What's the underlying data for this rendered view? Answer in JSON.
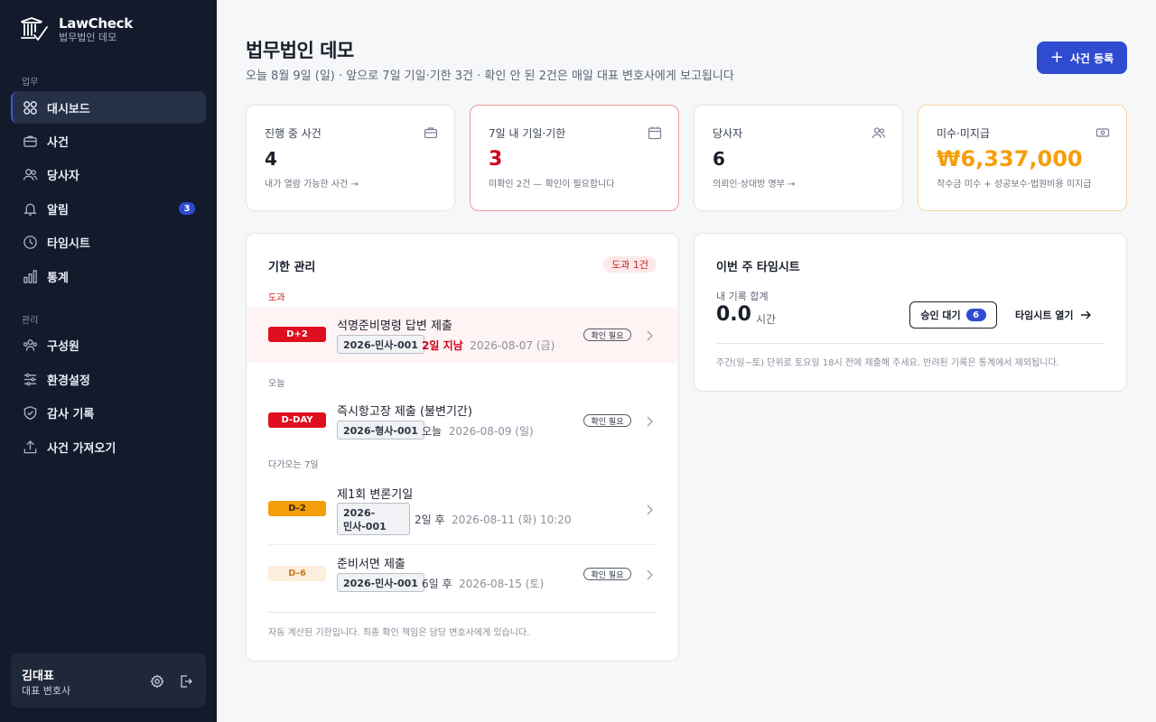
{
  "brand": {
    "name": "LawCheck",
    "firm": "법무법인 데모"
  },
  "sidebar": {
    "section_work": "업무",
    "section_admin": "관리",
    "items": [
      {
        "label": "대시보드",
        "icon": "grid-icon",
        "active": true
      },
      {
        "label": "사건",
        "icon": "briefcase-icon"
      },
      {
        "label": "당사자",
        "icon": "users-icon"
      },
      {
        "label": "알림",
        "icon": "bell-icon",
        "badge": "3"
      },
      {
        "label": "타임시트",
        "icon": "clock-icon"
      },
      {
        "label": "통계",
        "icon": "bar-chart-icon"
      }
    ],
    "admin_items": [
      {
        "label": "구성원",
        "icon": "members-icon"
      },
      {
        "label": "환경설정",
        "icon": "sliders-icon"
      },
      {
        "label": "감사 기록",
        "icon": "shield-icon"
      },
      {
        "label": "사건 가져오기",
        "icon": "upload-icon"
      }
    ],
    "user": {
      "name": "김대표",
      "role": "대표 변호사"
    }
  },
  "header": {
    "title": "법무법인 데모",
    "subtitle": "오늘 8월 9일 (일) · 앞으로 7일 기일·기한 3건 · 확인 안 된 2건은 매일 대표 변호사에게 보고됩니다",
    "primary_button": "사건 등록"
  },
  "stats": [
    {
      "label": "진행 중 사건",
      "value": "4",
      "note": "내가 열람 가능한 사건 →",
      "icon": "briefcase-icon"
    },
    {
      "label": "7일 내 기일·기한",
      "value": "3",
      "note": "미확인 2건 — 확인이 필요합니다",
      "icon": "calendar-icon",
      "accent": "#d0021b"
    },
    {
      "label": "당사자",
      "value": "6",
      "note": "의뢰인·상대방 명부 →",
      "icon": "users-icon"
    },
    {
      "label": "미수·미지급",
      "value": "₩6,337,000",
      "note": "착수금 미수 + 성공보수·법원비용 미지급",
      "icon": "money-icon",
      "accent": "#f59e0b"
    }
  ],
  "deadlines": {
    "title": "기한 관리",
    "overdue_badge": "도과 1건",
    "groups": {
      "overdue": "도과",
      "today": "오늘",
      "upcoming": "다가오는 7일"
    },
    "confirm_label": "확인 필요",
    "rows": [
      {
        "tag": "D+2",
        "title": "석명준비명령 답변 제출",
        "case": "2026-민사-001",
        "relative": "2일 지남",
        "date": "2026-08-07 (금)",
        "needs_confirm": true
      },
      {
        "tag": "D-DAY",
        "title": "즉시항고장 제출 (불변기간)",
        "case": "2026-형사-001",
        "relative": "오늘",
        "date": "2026-08-09 (일)",
        "needs_confirm": true
      },
      {
        "tag": "D-2",
        "title": "제1회 변론기일",
        "case": "2026-민사-001",
        "case_line1": "2026-",
        "case_line2": "민사-001",
        "relative": "2일 후",
        "date": "2026-08-11 (화) 10:20",
        "needs_confirm": false
      },
      {
        "tag": "D-6",
        "title": "준비서면 제출",
        "case": "2026-민사-001",
        "relative": "6일 후",
        "date": "2026-08-15 (토)",
        "needs_confirm": true
      }
    ],
    "footer": "자동 계산된 기한입니다. 최종 확인 책임은 담당 변호사에게 있습니다."
  },
  "timesheet": {
    "title": "이번 주 타임시트",
    "total_label": "내 기록 합계",
    "total_value": "0.0",
    "unit": "시간",
    "approval_label": "승인 대기",
    "approval_count": "6",
    "open_label": "타임시트 열기",
    "note": "주간(일~토) 단위로 토요일 18시 전에 제출해 주세요. 반려된 기록은 통계에서 제외됩니다."
  }
}
